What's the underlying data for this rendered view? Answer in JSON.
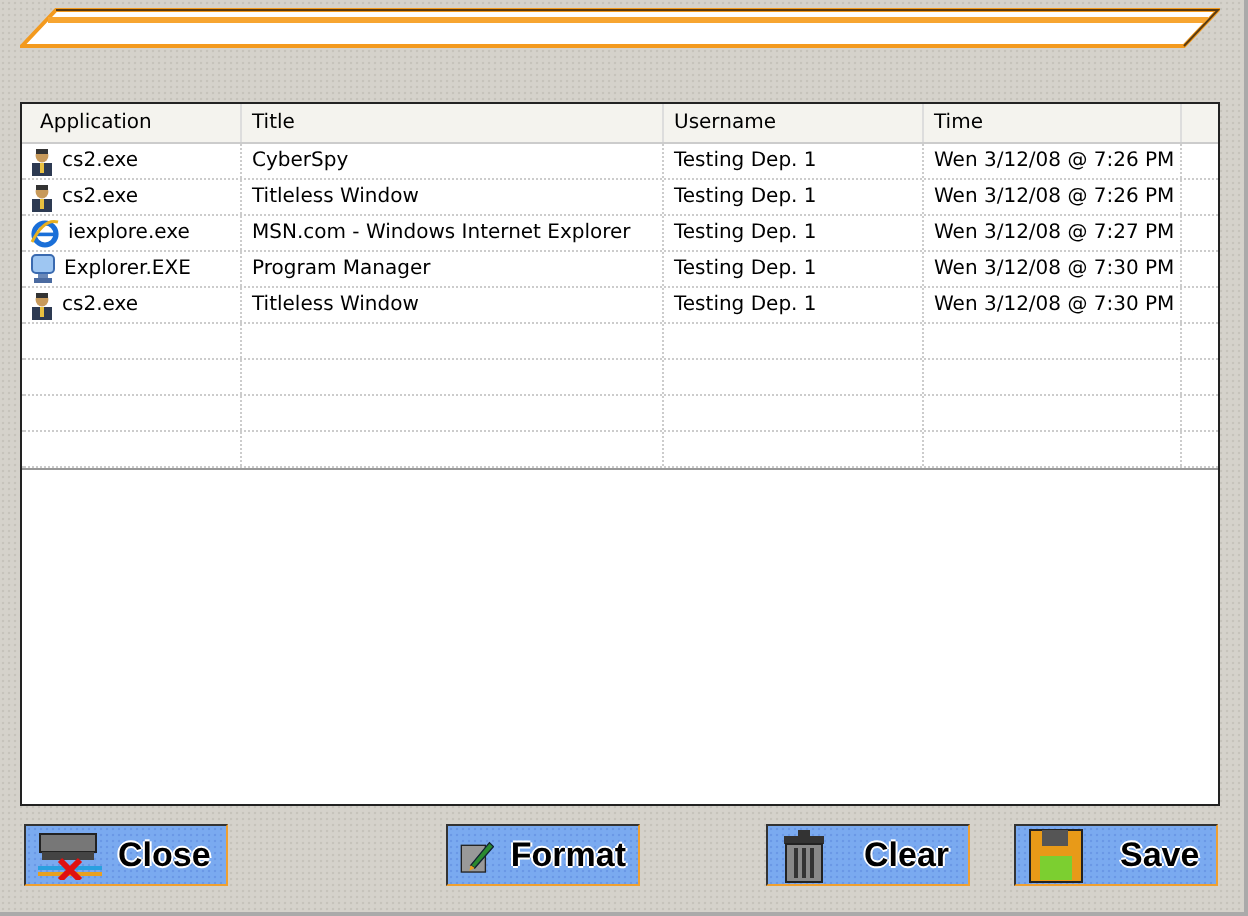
{
  "table": {
    "columns": [
      "Application",
      "Title",
      "Username",
      "Time"
    ],
    "rows": [
      {
        "kind": "agent",
        "application": "cs2.exe",
        "title": "CyberSpy",
        "username": "Testing Dep. 1",
        "time": "Wen 3/12/08 @ 7:26 PM"
      },
      {
        "kind": "agent",
        "application": "cs2.exe",
        "title": "Titleless Window",
        "username": "Testing Dep. 1",
        "time": "Wen 3/12/08 @ 7:26 PM"
      },
      {
        "kind": "browser",
        "application": "iexplore.exe",
        "title": "MSN.com - Windows Internet Explorer",
        "username": "Testing Dep. 1",
        "time": "Wen 3/12/08 @ 7:27 PM"
      },
      {
        "kind": "monitor",
        "application": "Explorer.EXE",
        "title": "Program Manager",
        "username": "Testing Dep. 1",
        "time": "Wen 3/12/08 @ 7:30 PM"
      },
      {
        "kind": "agent",
        "application": "cs2.exe",
        "title": "Titleless Window",
        "username": "Testing Dep. 1",
        "time": "Wen 3/12/08 @ 7:30 PM"
      }
    ]
  },
  "buttons": [
    {
      "kind": "close",
      "label": "Close"
    },
    {
      "kind": "format",
      "label": "Format"
    },
    {
      "kind": "clear",
      "label": "Clear"
    },
    {
      "kind": "save",
      "label": "Save"
    }
  ]
}
